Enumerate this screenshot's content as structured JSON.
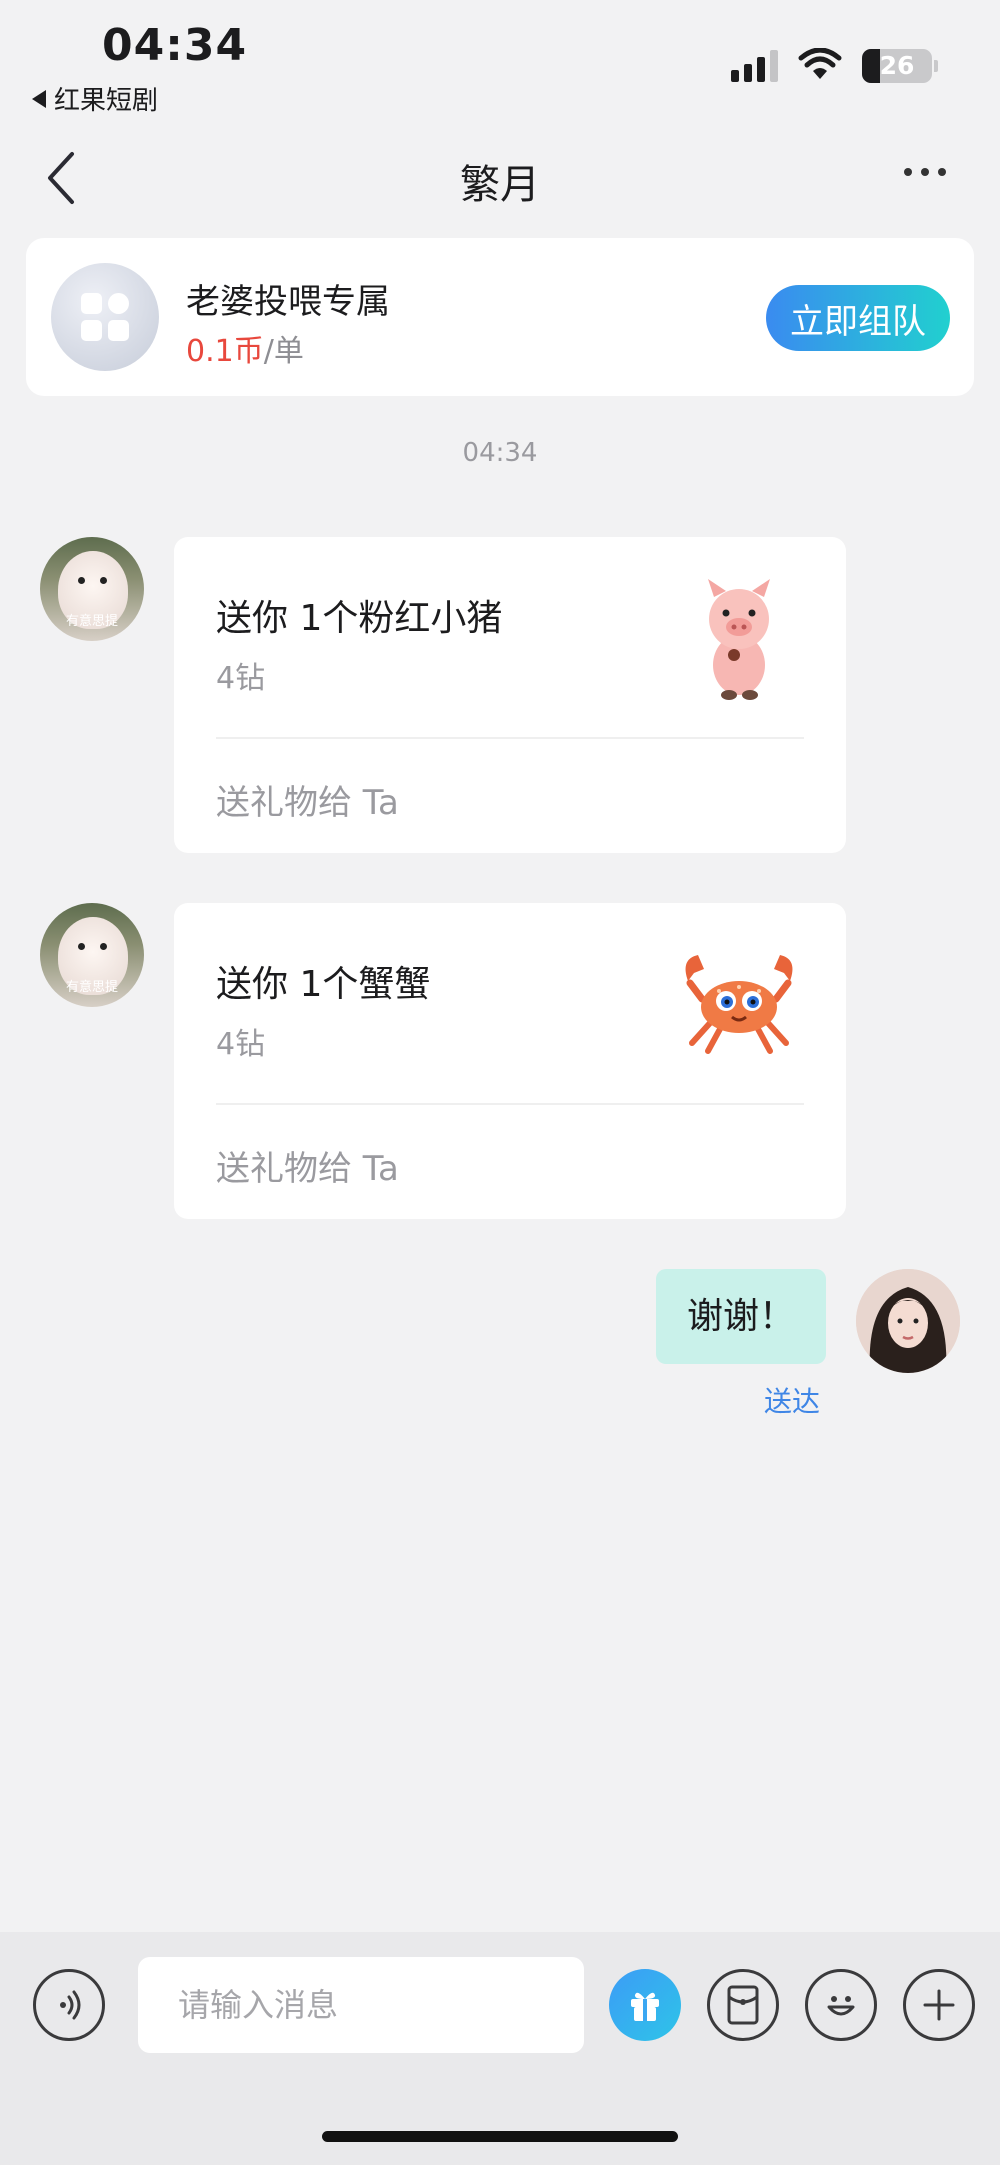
{
  "status_bar": {
    "time": "04:34",
    "back_app": "红果短剧",
    "battery": "26",
    "battery_level": 0.26
  },
  "header": {
    "title": "繁月"
  },
  "team_card": {
    "name": "老婆投喂专属",
    "price_value": "0.1币",
    "price_unit": "/单",
    "join_label": "立即组队"
  },
  "conversation": {
    "timestamp": "04:34",
    "gifts": [
      {
        "title": "送你 1个粉红小猪",
        "price": "4钻",
        "action": "送礼物给 Ta",
        "icon": "pink-pig-icon",
        "avatar_caption": "有意思提"
      },
      {
        "title": "送你 1个蟹蟹",
        "price": "4钻",
        "action": "送礼物给 Ta",
        "icon": "crab-icon",
        "avatar_caption": "有意思提"
      }
    ],
    "my_message": {
      "text": "谢谢！",
      "status": "送达"
    }
  },
  "input_bar": {
    "placeholder": "请输入消息",
    "icons": [
      "voice-icon",
      "gift-icon",
      "red-packet-icon",
      "emoji-icon",
      "plus-icon"
    ]
  },
  "colors": {
    "accent_start": "#3a8bf0",
    "accent_end": "#21d0cf",
    "price_red": "#e8483d",
    "my_bubble": "#c9f1ea",
    "delivered_blue": "#3f86e6"
  }
}
